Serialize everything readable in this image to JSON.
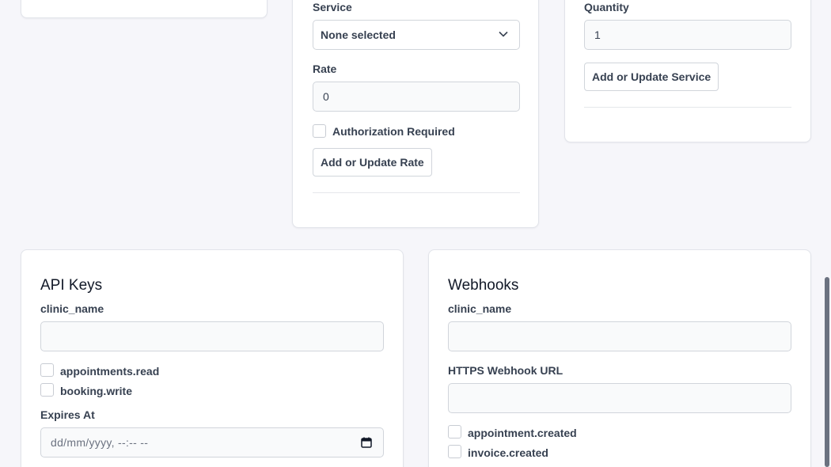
{
  "rate_card": {
    "service_label": "Service",
    "service_value": "None selected",
    "rate_label": "Rate",
    "rate_value": "0",
    "authorization_label": "Authorization Required",
    "add_rate_button": "Add or Update Rate"
  },
  "service_card": {
    "quantity_label": "Quantity",
    "quantity_value": "1",
    "add_service_button": "Add or Update Service"
  },
  "api_keys": {
    "title": "API Keys",
    "clinic_label": "clinic_name",
    "clinic_value": "",
    "scopes": [
      "appointments.read",
      "booking.write"
    ],
    "expires_label": "Expires At",
    "expires_placeholder": "dd/mm/yyyy, --:-- --"
  },
  "webhooks": {
    "title": "Webhooks",
    "clinic_label": "clinic_name",
    "clinic_value": "",
    "url_label": "HTTPS Webhook URL",
    "url_value": "",
    "events": [
      "appointment.created",
      "invoice.created"
    ]
  },
  "icons": {
    "select_chevron": "chevron-down-icon",
    "date_picker": "calendar-icon"
  },
  "colors": {
    "page_bg": "#f6f6fa",
    "card_bg": "#ffffff",
    "border": "#d1d5db"
  }
}
